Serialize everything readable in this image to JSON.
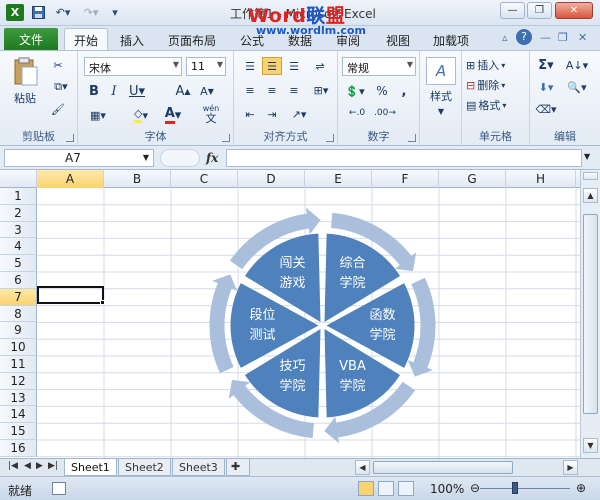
{
  "window": {
    "title": "工作簿1 - Microsoft Excel",
    "watermark": {
      "part1": "Word",
      "part2": "联",
      "part3": "盟"
    },
    "watermark_url": "www.wordlm.com",
    "colors": {
      "accent": "#1f7a1f",
      "diagram_fill": "#4f81bd",
      "diagram_arrow": "#a9bfdc"
    }
  },
  "tabs": {
    "file": "文件",
    "items": [
      {
        "label": "开始"
      },
      {
        "label": "插入"
      },
      {
        "label": "页面布局"
      },
      {
        "label": "公式"
      },
      {
        "label": "数据"
      },
      {
        "label": "审阅"
      },
      {
        "label": "视图"
      },
      {
        "label": "加载项"
      }
    ]
  },
  "ribbon": {
    "clipboard": {
      "label": "剪贴板",
      "paste": "粘贴"
    },
    "font": {
      "label": "字体",
      "font_name": "宋体",
      "font_size": "11",
      "wen": "wén",
      "wen_char": "文"
    },
    "alignment": {
      "label": "对齐方式"
    },
    "number": {
      "label": "数字",
      "format": "常规",
      "percent": "%",
      "comma": ","
    },
    "styles": {
      "label": "样式"
    },
    "cells": {
      "label": "单元格",
      "insert": "插入",
      "delete": "删除",
      "format": "格式"
    },
    "editing": {
      "label": "编辑"
    }
  },
  "formula_bar": {
    "name_box": "A7",
    "fx": "fx",
    "value": ""
  },
  "sheet": {
    "columns": [
      "A",
      "B",
      "C",
      "D",
      "E",
      "F",
      "G",
      "H"
    ],
    "rows": [
      "1",
      "2",
      "3",
      "4",
      "5",
      "6",
      "7",
      "8",
      "9",
      "10",
      "11",
      "12",
      "13",
      "14",
      "15",
      "16"
    ],
    "active_cell": "A7"
  },
  "diagram": {
    "segments": [
      {
        "line1": "综合",
        "line2": "学院"
      },
      {
        "line1": "函数",
        "line2": "学院"
      },
      {
        "line1": "VBA",
        "line2": "学院"
      },
      {
        "line1": "技巧",
        "line2": "学院"
      },
      {
        "line1": "段位",
        "line2": "测试"
      },
      {
        "line1": "闯关",
        "line2": "游戏"
      }
    ]
  },
  "sheet_tabs": [
    "Sheet1",
    "Sheet2",
    "Sheet3"
  ],
  "status": {
    "ready": "就绪",
    "zoom": "100%"
  }
}
